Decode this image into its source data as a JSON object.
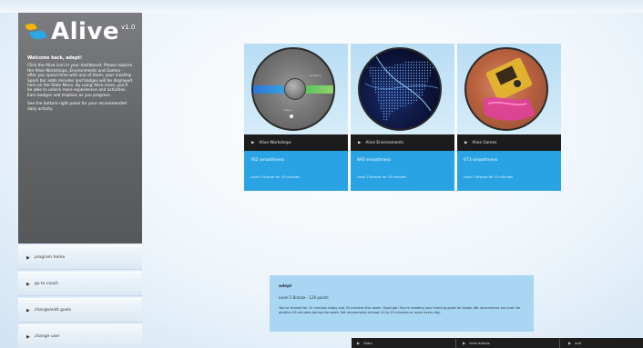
{
  "app": {
    "logo_text": "Alive",
    "logo_version": "v1.0"
  },
  "sidebar": {
    "welcome_heading": "Welcome back, adept!",
    "welcome_body": "Click the Alive icon in your dashboard. Please explore the Alive Workshops, Environments and Games - after you spend time with one of them, your monthly Spark bar adds minutes and badges will be displayed here on the Stats Menu. By using Alive more, you'll be able to unlock more experiences and activities. Earn badges and trophies as you progress.",
    "welcome_note": "See the bottom-right panel for your recommended daily activity.",
    "buttons": [
      {
        "label": "program home"
      },
      {
        "label": "go to coach"
      },
      {
        "label": "change/edit goals"
      },
      {
        "label": "change user"
      }
    ]
  },
  "cards": [
    {
      "title": "Alive Workshops",
      "amount": "762 smoothness",
      "last": "Level 2 Bronze for 15 minutes"
    },
    {
      "title": "Alive Environments",
      "amount": "893 smoothness",
      "last": "Level 2 Bronze for 15 minutes"
    },
    {
      "title": "Alive Games",
      "amount": "673 smoothness",
      "last": "Level 2 Bronze for 15 minutes"
    }
  ],
  "detail": {
    "title": "adept",
    "level": "Level 1 Bronze - 126 points",
    "body": "You've trained for 15 minutes today and 35 minutes this week. Good job! You're meeting your training goals for today. We recommend you train for another 45 minutes during the week. We recommend at least 10 to 15 minutes or more every day."
  },
  "bottom_bar": {
    "items": [
      {
        "label": "Stats"
      },
      {
        "label": "view details"
      },
      {
        "label": "exit"
      }
    ]
  },
  "colors": {
    "accent": "#29a3e3",
    "dark_strip": "#1c1c1c",
    "sidebar": "#6b6d70"
  }
}
